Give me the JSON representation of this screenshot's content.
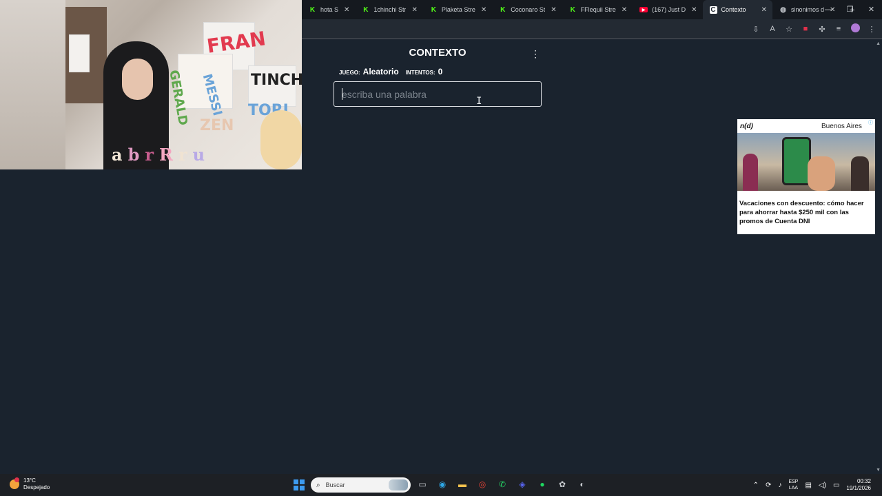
{
  "browser": {
    "tabs": [
      {
        "label": "hota S",
        "favicon": "kick-icon",
        "active": false
      },
      {
        "label": "1chinchi Str",
        "favicon": "kick-icon",
        "active": false
      },
      {
        "label": "Plaketa Stre",
        "favicon": "kick-icon",
        "active": false
      },
      {
        "label": "Coconaro St",
        "favicon": "kick-icon",
        "active": false
      },
      {
        "label": "FFlequii Stre",
        "favicon": "kick-icon",
        "active": false
      },
      {
        "label": "(167) Just D",
        "favicon": "youtube-icon",
        "active": false
      },
      {
        "label": "Contexto",
        "favicon": "contexto-icon",
        "active": true
      },
      {
        "label": "sinonimos d",
        "favicon": "globe-icon",
        "active": false
      }
    ]
  },
  "game": {
    "title": "CONTEXTO",
    "game_label": "juego:",
    "game_value": "Aleatorio",
    "attempts_label": "intentos:",
    "attempts_value": "0",
    "input_placeholder": "escriba una palabra"
  },
  "webcam": {
    "handwritten_names": [
      "FRAN",
      "GERALD",
      "MESSI",
      "TINCHO",
      "TORI",
      "ZEN"
    ],
    "overlay_letters": [
      "a",
      "b",
      "r",
      "R",
      "r",
      "u"
    ]
  },
  "ad": {
    "brand": "n(d)",
    "city": "Buenos Aires",
    "headline": "Vacaciones con descuento: cómo hacer para ahorrar hasta $250 mil con las promos de Cuenta DNI"
  },
  "taskbar": {
    "temperature": "13°C",
    "weather_desc": "Despejado",
    "search_placeholder": "Buscar",
    "lang_top": "ESP",
    "lang_bottom": "LAA",
    "time": "00:32",
    "date": "19/1/2026"
  },
  "colors": {
    "page_bg": "#1a232e",
    "kick_green": "#53fc18",
    "windows_blue": "#3d9bf0"
  }
}
